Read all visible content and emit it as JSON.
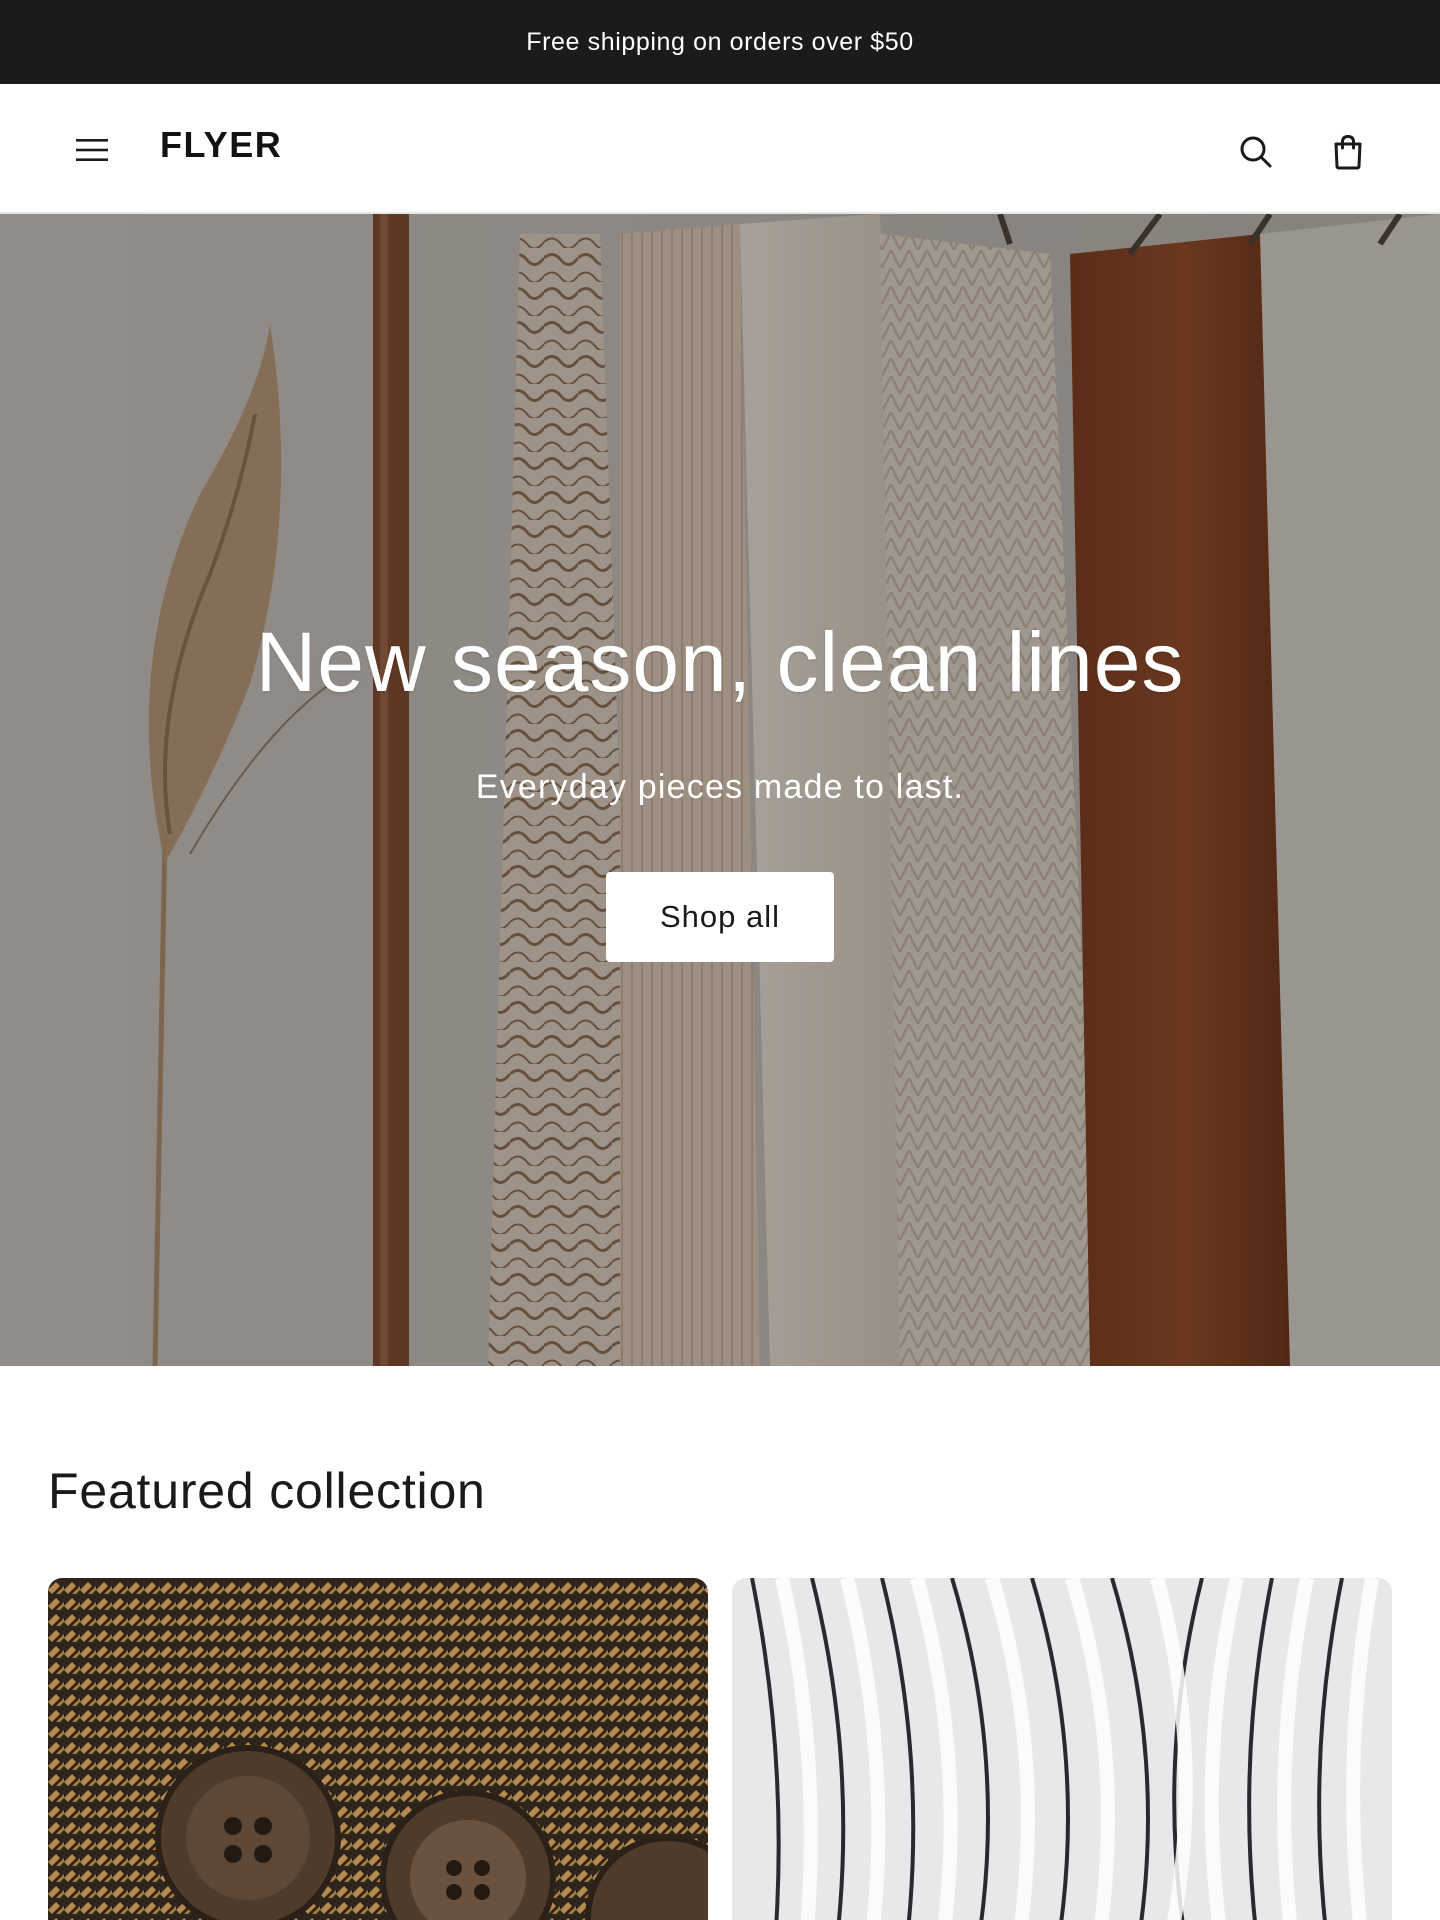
{
  "announcement": {
    "text": "Free shipping on orders over $50"
  },
  "header": {
    "logo": "FLYER",
    "icons": {
      "menu": "hamburger-menu-icon",
      "search": "search-icon",
      "cart": "shopping-bag-icon"
    }
  },
  "hero": {
    "title": "New season, clean lines",
    "subtitle": "Everyday pieces made to last.",
    "cta_label": "Shop all"
  },
  "featured": {
    "heading": "Featured collection",
    "products": [
      {
        "image": "tweed-fabric-with-buttons"
      },
      {
        "image": "white-cotton-rope-yarn"
      }
    ]
  },
  "colors": {
    "announcement_bg": "#1b1b1b",
    "text": "#1a1a1a",
    "button_bg": "#ffffff"
  }
}
